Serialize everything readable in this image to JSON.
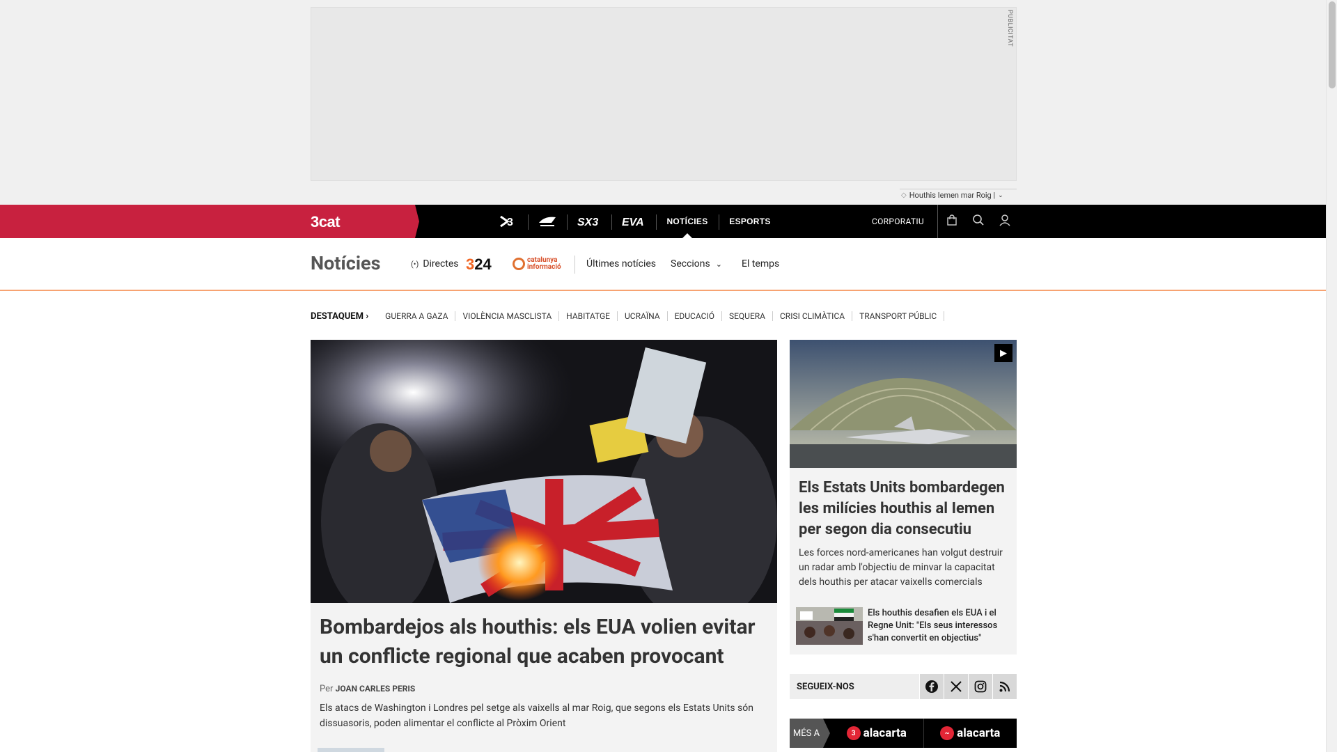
{
  "ad": {
    "label": "PUBLICITAT"
  },
  "breaking": {
    "text": "Houthis Iemen mar Roig |"
  },
  "brand": {
    "logo": "3cat"
  },
  "channels": [
    {
      "label": "3",
      "kind": "logo"
    },
    {
      "label": "Cat Ràdio",
      "kind": "logo"
    },
    {
      "label": "SX3",
      "kind": "logo"
    },
    {
      "label": "EVA",
      "kind": "logo"
    },
    {
      "label": "NOTÍCIES",
      "kind": "text",
      "active": true
    },
    {
      "label": "ESPORTS",
      "kind": "text"
    }
  ],
  "nav_right": {
    "corporate": "CORPORATIU",
    "icons": [
      "shopping-bag-icon",
      "search-icon",
      "user-icon"
    ]
  },
  "section": {
    "title": "Notícies",
    "directes": "Directes",
    "logo_324": "324",
    "logo_ci": "catalunya informació",
    "links": [
      "Últimes notícies",
      "Seccions",
      "El temps"
    ]
  },
  "topics": {
    "lead": "DESTAQUEM",
    "items": [
      "GUERRA A GAZA",
      "VIOLÈNCIA MASCLISTA",
      "HABITATGE",
      "UCRAÏNA",
      "EDUCACIÓ",
      "SEQUERA",
      "CRISI CLIMÀTICA",
      "TRANSPORT PÚBLIC"
    ]
  },
  "hero": {
    "title": "Bombardejos als houthis: els EUA volien evitar un conflicte regional que acaben provocant",
    "byline_prefix": "Per",
    "author": "JOAN CARLES PERIS",
    "lead": "Els atacs de Washington i Londres pel setge als vaixells al mar Roig, que segons els Estats Units són dissuasoris, poden alimentar el conflicte al Pròxim Orient"
  },
  "side": {
    "title": "Els Estats Units bombardegen les milícies houthis al Iemen per segon dia consecutiu",
    "lead": "Les forces nord-americanes han volgut destruir un radar amb l'objectiu de minvar la capacitat dels houthis per atacar vaixells comercials",
    "related": "Els houthis desafien els EUA i el Regne Unit: \"Els seus interessos s'han convertit en objectius\""
  },
  "follow": {
    "label": "SEGUEIX-NOS",
    "networks": [
      "facebook-icon",
      "x-icon",
      "instagram-icon",
      "rss-icon"
    ]
  },
  "mes": {
    "label": "MÉS A",
    "apps": [
      "alacarta",
      "alacarta"
    ]
  }
}
